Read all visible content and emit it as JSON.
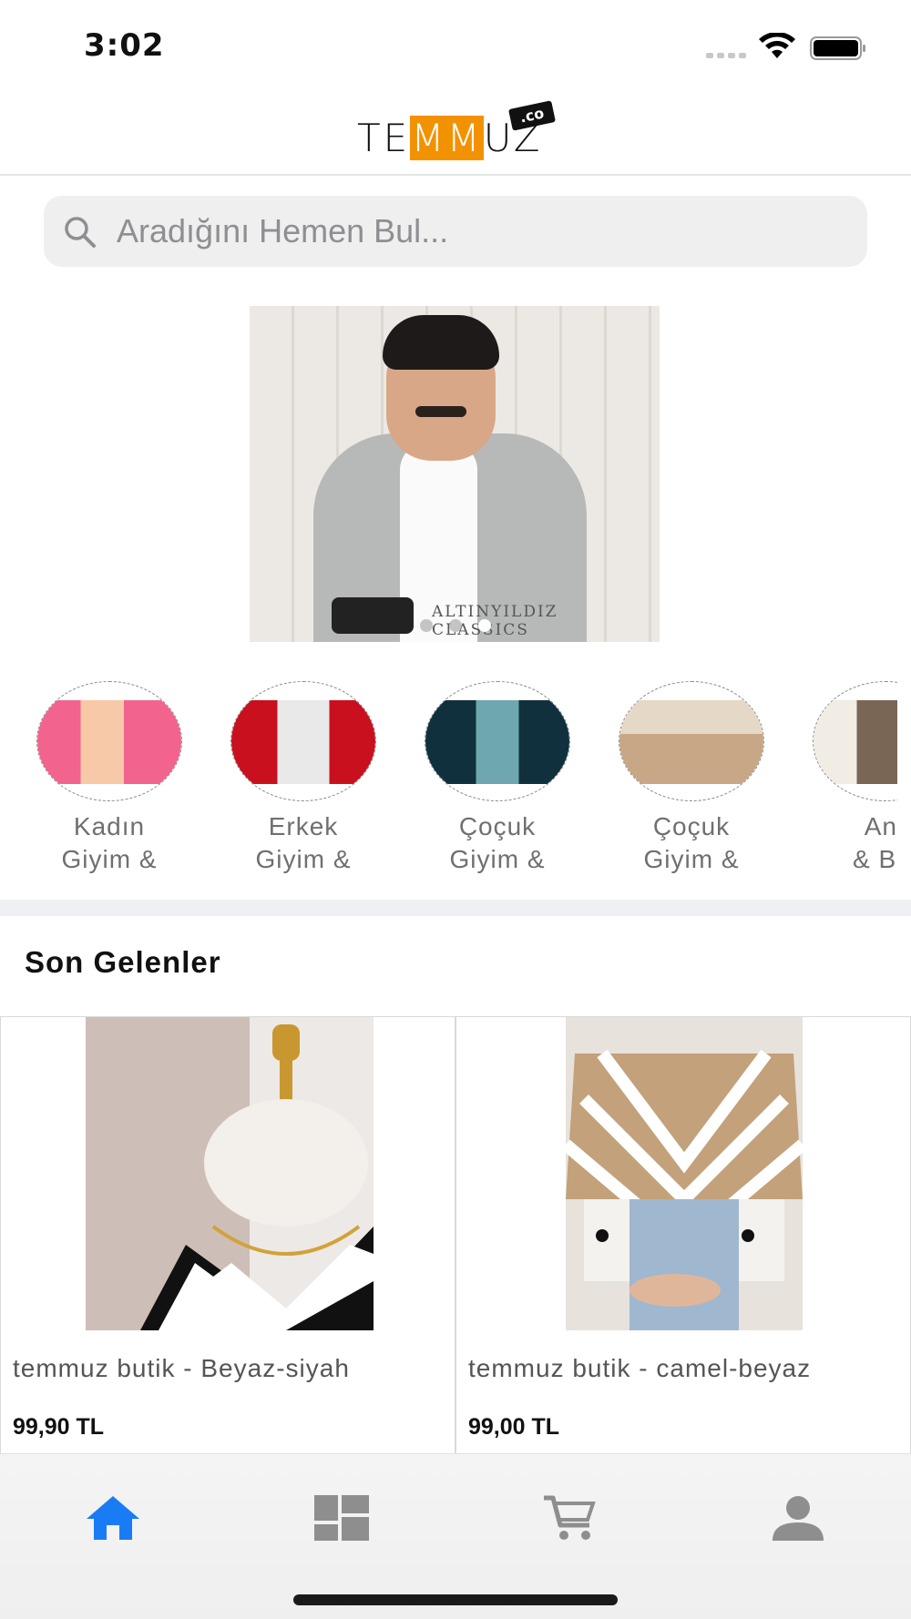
{
  "status_bar": {
    "time": "3:02"
  },
  "header": {
    "logo_text_left": "TE",
    "logo_text_orange": "MM",
    "logo_text_right": "UZ",
    "logo_badge": ".co"
  },
  "search": {
    "placeholder": "Aradığını Hemen Bul..."
  },
  "banner": {
    "caption": "ALTINYILDIZ CLASSICS",
    "slide_count": 3,
    "active_slide": 3
  },
  "categories": [
    {
      "line1": "Kadın",
      "line2": "Giyim &"
    },
    {
      "line1": "Erkek",
      "line2": "Giyim &"
    },
    {
      "line1": "Çoçuk",
      "line2": "Giyim &"
    },
    {
      "line1": "Çoçuk",
      "line2": "Giyim &"
    },
    {
      "line1": "Anr",
      "line2": "& Bel"
    }
  ],
  "section": {
    "title": "Son Gelenler"
  },
  "products": [
    {
      "name": "temmuz butik - Beyaz-siyah",
      "price": "99,90 TL"
    },
    {
      "name": "temmuz butik - camel-beyaz",
      "price": "99,00 TL"
    }
  ],
  "tabbar": {
    "items": [
      {
        "icon": "home-icon",
        "active": true
      },
      {
        "icon": "categories-icon",
        "active": false
      },
      {
        "icon": "cart-icon",
        "active": false
      },
      {
        "icon": "profile-icon",
        "active": false
      }
    ],
    "active_color": "#1a7cf5",
    "inactive_color": "#8e8e8e"
  },
  "colors": {
    "brand_orange": "#f39200",
    "search_bg": "#efefef"
  }
}
